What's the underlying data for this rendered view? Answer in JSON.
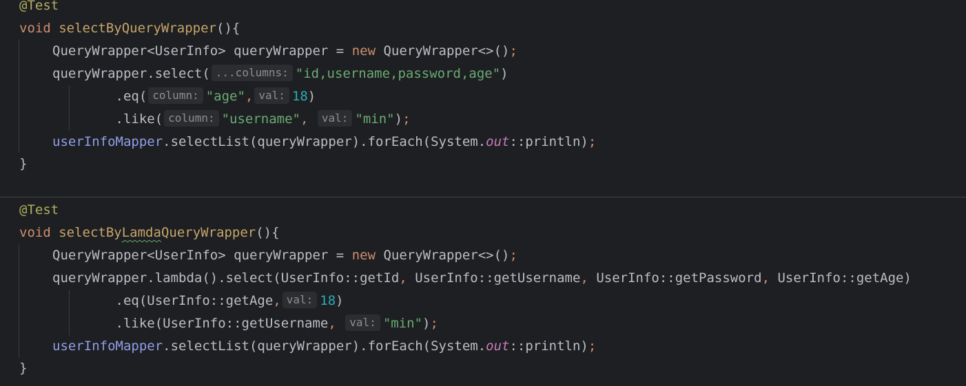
{
  "editor": {
    "method1": {
      "annotation": "@Test",
      "ret_type": "void",
      "name": "selectByQueryWrapper",
      "sig_tail": "(){",
      "l1_type": "QueryWrapper<UserInfo> queryWrapper = ",
      "l1_new": "new",
      "l1_ctor": " QueryWrapper<>()",
      "semi": ";",
      "l2_call": "queryWrapper.select(",
      "hint_columns": "...columns:",
      "l2_arg": "\"id,username,password,age\"",
      "close_paren": ")",
      "l3_call": "        .eq(",
      "hint_column": "column:",
      "l3_arg1": "\"age\"",
      "comma": ",",
      "hint_val": "val:",
      "l3_num": "18",
      "l4_call": "        .like(",
      "l4_arg1": "\"username\"",
      "l4_arg2": "\"min\"",
      "l5_field": "userInfoMapper",
      "l5_mid": ".selectList(queryWrapper).forEach(System.",
      "l5_static": "out",
      "l5_end": "::println)",
      "close_brace": "}"
    },
    "method2": {
      "annotation": "@Test",
      "ret_type": "void",
      "name_prefix": "selectBy",
      "name_typo": "Lamda",
      "name_suffix": "QueryWrapper",
      "sig_tail": "(){",
      "l2_a": "queryWrapper.lambda().select(UserInfo::getId",
      "l2_b": " UserInfo::getUsername",
      "l2_c": " UserInfo::getPassword",
      "l2_d": " UserInfo::getAge)",
      "l3_call": "        .eq(UserInfo::getAge",
      "l4_call": "        .like(UserInfo::getUsername",
      "l4_arg": "\"min\""
    }
  }
}
